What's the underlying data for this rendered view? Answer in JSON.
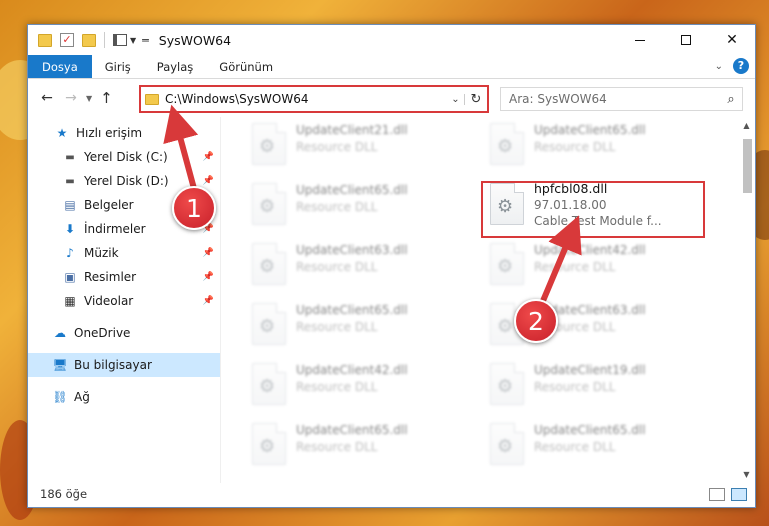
{
  "window": {
    "title": "SysWOW64"
  },
  "ribbon": {
    "tabs": [
      "Dosya",
      "Giriş",
      "Paylaş",
      "Görünüm"
    ],
    "help_label": "?"
  },
  "navbar": {
    "address": "C:\\Windows\\SysWOW64",
    "search_placeholder": "Ara: SysWOW64"
  },
  "sidebar": {
    "items": [
      {
        "label": "Hızlı erişim",
        "icon": "star-icon"
      },
      {
        "label": "Yerel Disk (C:)",
        "icon": "drive-icon"
      },
      {
        "label": "Yerel Disk (D:)",
        "icon": "drive-icon"
      },
      {
        "label": "Belgeler",
        "icon": "document-icon"
      },
      {
        "label": "İndirmeler",
        "icon": "download-icon"
      },
      {
        "label": "Müzik",
        "icon": "music-icon"
      },
      {
        "label": "Resimler",
        "icon": "pictures-icon"
      },
      {
        "label": "Videolar",
        "icon": "video-icon"
      },
      {
        "label": "OneDrive",
        "icon": "cloud-icon"
      },
      {
        "label": "Bu bilgisayar",
        "icon": "computer-icon"
      },
      {
        "label": "Ağ",
        "icon": "network-icon"
      }
    ]
  },
  "files": [
    {
      "name": "UpdateClient21.dll",
      "desc": "Resource DLL"
    },
    {
      "name": "UpdateClient65.dll",
      "desc": "Resource DLL"
    },
    {
      "name": "UpdateClient65.dll",
      "desc": "Resource DLL"
    },
    {
      "name": "hpfcbl08.dll",
      "version": "97.01.18.00",
      "desc": "Cable Test Module f..."
    },
    {
      "name": "UpdateClient63.dll",
      "desc": "Resource DLL"
    },
    {
      "name": "UpdateClient42.dll",
      "desc": "Resource DLL"
    },
    {
      "name": "UpdateClient65.dll",
      "desc": "Resource DLL"
    },
    {
      "name": "UpdateClient63.dll",
      "desc": "Resource DLL"
    },
    {
      "name": "UpdateClient42.dll",
      "desc": "Resource DLL"
    },
    {
      "name": "UpdateClient19.dll",
      "desc": "Resource DLL"
    },
    {
      "name": "UpdateClient65.dll",
      "desc": "Resource DLL"
    },
    {
      "name": "UpdateClient65.dll",
      "desc": "Resource DLL"
    }
  ],
  "status": {
    "count": "186 öğe"
  },
  "annotations": {
    "badge1": "1",
    "badge2": "2",
    "accent_color": "#d8393a"
  }
}
